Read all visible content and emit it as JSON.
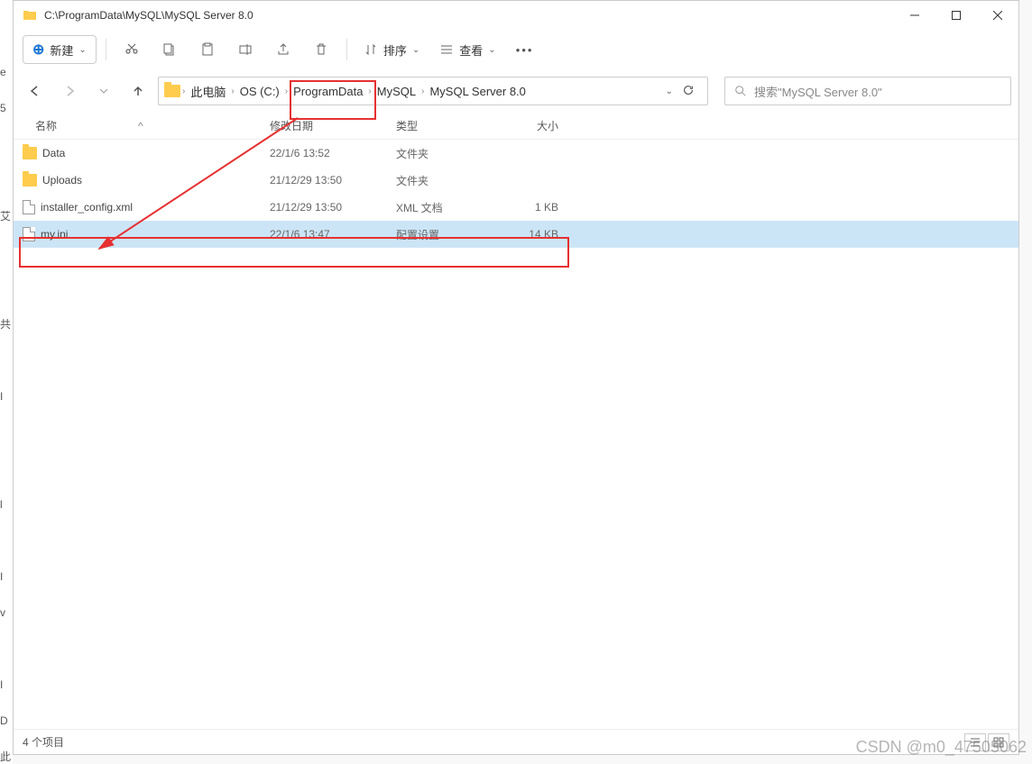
{
  "window": {
    "title": "C:\\ProgramData\\MySQL\\MySQL Server 8.0"
  },
  "toolbar": {
    "new_label": "新建",
    "sort_label": "排序",
    "view_label": "查看"
  },
  "breadcrumb": {
    "items": [
      "此电脑",
      "OS (C:)",
      "ProgramData",
      "MySQL",
      "MySQL Server 8.0"
    ]
  },
  "search": {
    "placeholder": "搜索\"MySQL Server 8.0\""
  },
  "columns": {
    "name": "名称",
    "sort_indicator": "^",
    "modified": "修改日期",
    "type": "类型",
    "size": "大小"
  },
  "files": [
    {
      "name": "Data",
      "modified": "22/1/6 13:52",
      "type": "文件夹",
      "size": "",
      "icon": "folder"
    },
    {
      "name": "Uploads",
      "modified": "21/12/29 13:50",
      "type": "文件夹",
      "size": "",
      "icon": "folder"
    },
    {
      "name": "installer_config.xml",
      "modified": "21/12/29 13:50",
      "type": "XML 文档",
      "size": "1 KB",
      "icon": "file"
    },
    {
      "name": "my.ini",
      "modified": "22/1/6 13:47",
      "type": "配置设置",
      "size": "14 KB",
      "icon": "file",
      "selected": true
    }
  ],
  "status": {
    "count": "4 个项目"
  },
  "watermark": "CSDN @m0_47505062"
}
